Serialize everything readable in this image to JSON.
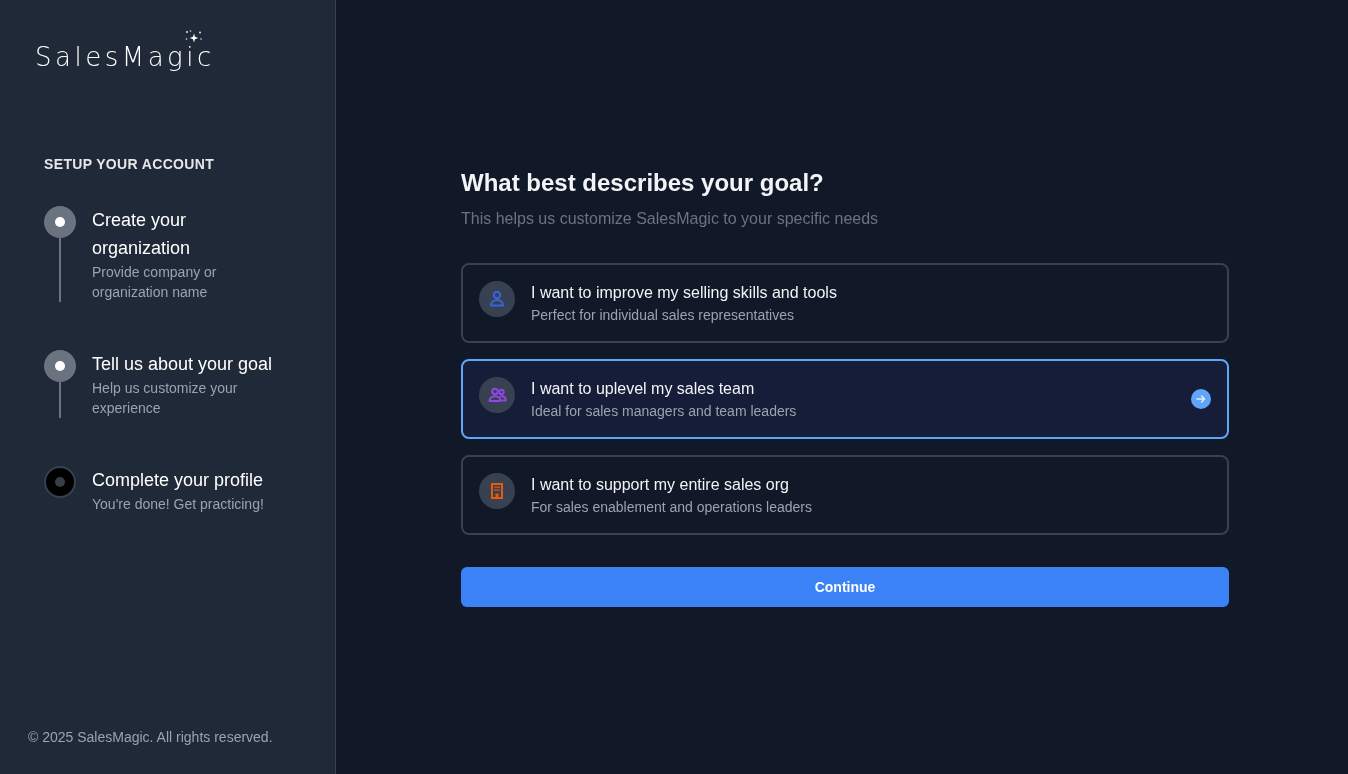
{
  "sidebar": {
    "logo": {
      "text": "SalesMagic"
    },
    "section_title": "SETUP YOUR ACCOUNT",
    "steps": [
      {
        "title": "Create your organization",
        "description": "Provide company or organization name",
        "completed": true
      },
      {
        "title": "Tell us about your goal",
        "description": "Help us customize your experience",
        "completed": true
      },
      {
        "title": "Complete your profile",
        "description": "You're done! Get practicing!",
        "completed": false
      }
    ],
    "footer": "© 2025 SalesMagic. All rights reserved."
  },
  "main": {
    "title": "What best describes your goal?",
    "subtitle": "This helps us customize SalesMagic to your specific needs",
    "options": [
      {
        "kind": "person",
        "color": "#3b63dc",
        "title": "I want to improve my selling skills and tools",
        "description": "Perfect for individual sales representatives",
        "selected": false
      },
      {
        "kind": "team",
        "color": "#9146e8",
        "title": "I want to uplevel my sales team",
        "description": "Ideal for sales managers and team leaders",
        "selected": true
      },
      {
        "kind": "building",
        "color": "#ea580c",
        "title": "I want to support my entire sales org",
        "description": "For sales enablement and operations leaders",
        "selected": false
      }
    ],
    "continue_button": "Continue"
  }
}
